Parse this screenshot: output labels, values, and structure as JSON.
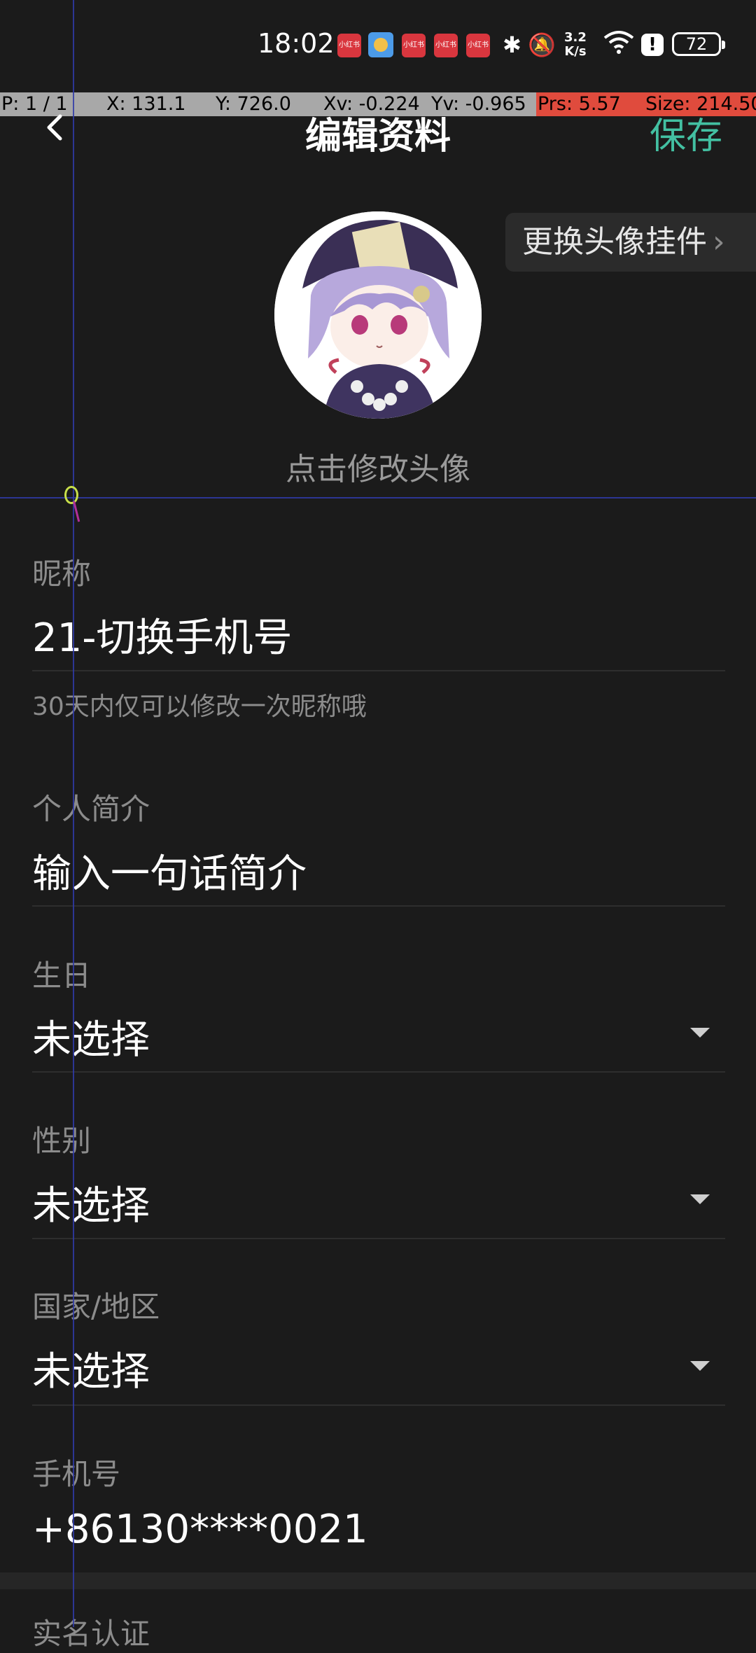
{
  "status_bar": {
    "time": "18:02",
    "notification_label": "小红书",
    "net_speed_value": "3.2",
    "net_speed_unit": "K/s",
    "battery": "72"
  },
  "debug_overlay": {
    "pointer": "P: 1 / 1",
    "x": "X: 131.1",
    "y": "Y: 726.0",
    "xv": "Xv: -0.224",
    "yv": "Yv: -0.965",
    "prs": "Prs: 5.57",
    "size": "Size: 214.50"
  },
  "header": {
    "title": "编辑资料",
    "save_label": "保存"
  },
  "avatar": {
    "change_pendant_label": "更换头像挂件",
    "hint": "点击修改头像"
  },
  "form": {
    "nickname": {
      "label": "昵称",
      "value": "21-切换手机号",
      "hint": "30天内仅可以修改一次昵称哦"
    },
    "bio": {
      "label": "个人简介",
      "placeholder": "输入一句话简介"
    },
    "birthday": {
      "label": "生日",
      "value": "未选择"
    },
    "gender": {
      "label": "性别",
      "value": "未选择"
    },
    "region": {
      "label": "国家/地区",
      "value": "未选择"
    },
    "phone": {
      "label": "手机号",
      "value": "+86130****0021"
    },
    "next_section_label": "实名认证"
  },
  "colors": {
    "accent": "#43c0a2",
    "background": "#1b1b1b"
  }
}
